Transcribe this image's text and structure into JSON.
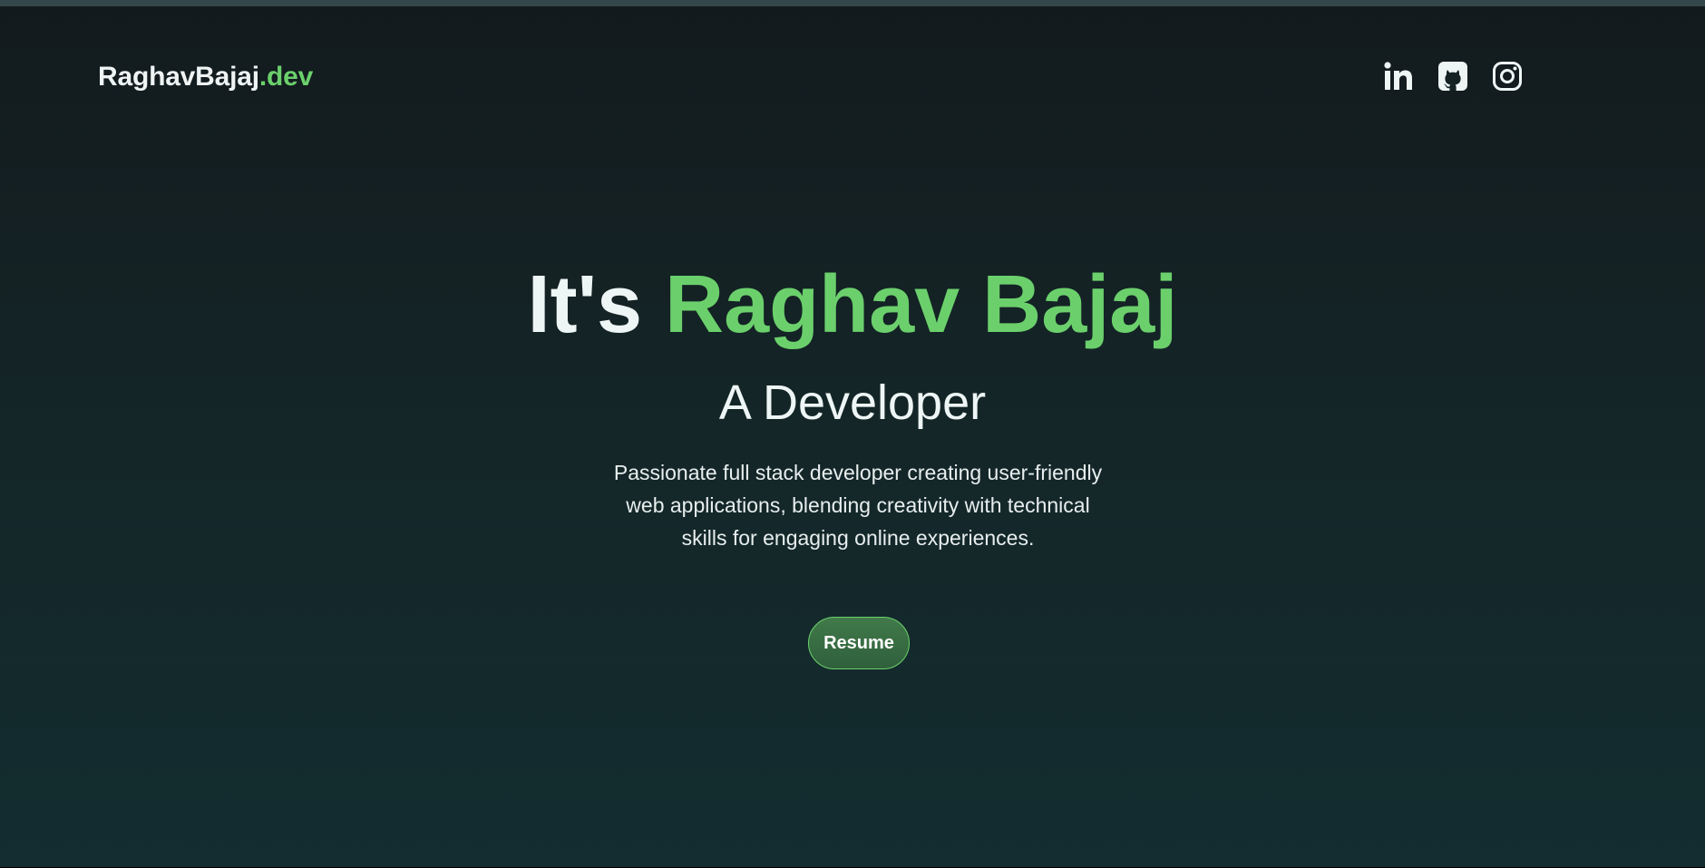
{
  "brand": {
    "name": "RaghavBajaj",
    "suffix": ".dev"
  },
  "socials": [
    {
      "name": "LinkedIn",
      "icon": "linkedin-icon"
    },
    {
      "name": "GitHub",
      "icon": "github-icon"
    },
    {
      "name": "Instagram",
      "icon": "instagram-icon"
    }
  ],
  "hero": {
    "greeting": "It's ",
    "name": "Raghav Bajaj",
    "role": "A Developer",
    "about": "Passionate full stack developer creating user-friendly web applications, blending creativity with technical skills for engaging online experiences.",
    "resume_label": "Resume"
  },
  "colors": {
    "accent": "#6bd06c",
    "text": "#eef5f5",
    "background_top": "#131a1d",
    "background_bottom": "#132d30"
  }
}
